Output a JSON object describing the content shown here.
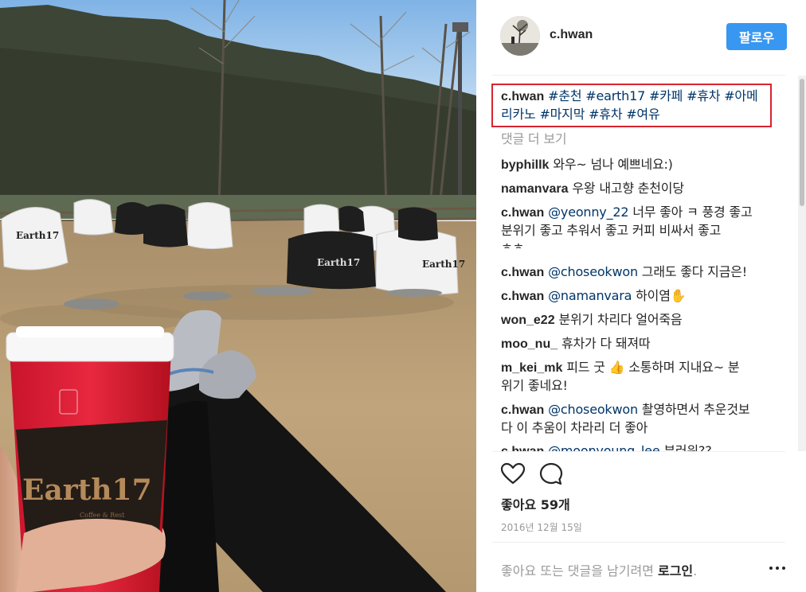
{
  "header": {
    "username": "c.hwan",
    "follow_label": "팔로우"
  },
  "caption": {
    "user": "c.hwan",
    "line1_tags": "#춘천 #earth17 #카페 #휴차 #아메",
    "line2_tags": "리카노 #마지막 #휴차 #여유"
  },
  "load_more": "댓글 더 보기",
  "comments": [
    {
      "user": "byphillk",
      "text": "와우~ 넘나 예쁘네요:)"
    },
    {
      "user": "namanvara",
      "text": "우왕 내고향 춘천이당"
    },
    {
      "user": "c.hwan",
      "mention": "@yeonny_22",
      "text": "너무 좋아 ㅋ 풍경 좋고",
      "cont": "분위기 좋고 추워서 좋고 커피 비싸서 좋고",
      "cont2": "ㅎㅎ"
    },
    {
      "user": "c.hwan",
      "mention": "@choseokwon",
      "text": "그래도 좋다 지금은!"
    },
    {
      "user": "c.hwan",
      "mention": "@namanvara",
      "text": "하이염✋"
    },
    {
      "user": "won_e22",
      "text": "분위기 차리다 얼어죽음"
    },
    {
      "user": "moo_nu_",
      "text": "휴차가 다 돼져따"
    },
    {
      "user": "m_kei_mk",
      "text": "피드 굿 👍 소통하며 지내요~ 분",
      "cont": "위기 좋네요!"
    },
    {
      "user": "c.hwan",
      "mention": "@choseokwon",
      "text": "촬영하면서 추운것보",
      "cont": "다 이 추움이 차라리 더 좋아"
    },
    {
      "user": "c.hwan",
      "mention": "@moonyoung_lee",
      "text": "부러워??"
    }
  ],
  "likes": "좋아요 59개",
  "date": "2016년 12월 15일",
  "footer": {
    "prompt": "좋아요 또는 댓글을 남기려면 ",
    "login": "로그인",
    "period": "."
  },
  "photo": {
    "cup_brand": "Earth17",
    "cup_sub": "Coffee & Rest",
    "bag_brand": "Earth17"
  },
  "colors": {
    "accent": "#3897f0",
    "highlight_border": "#d7242f",
    "hashtag": "#003569",
    "muted": "#999999"
  }
}
